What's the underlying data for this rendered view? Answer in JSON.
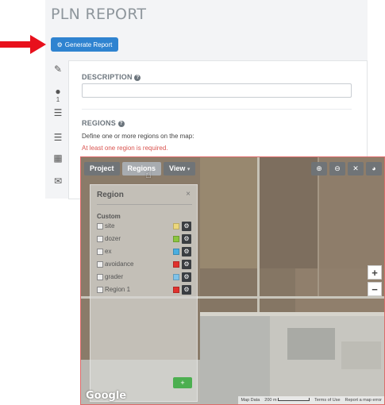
{
  "page": {
    "title": "PLN REPORT"
  },
  "actions": {
    "generate_label": "Generate Report",
    "generate_icon": "gears-icon"
  },
  "sidebar_icons": [
    {
      "name": "pencil-icon",
      "glyph": "✎"
    },
    {
      "name": "globe-icon",
      "glyph": "●",
      "count": "1"
    },
    {
      "name": "list-icon",
      "glyph": "☰"
    },
    {
      "name": "list-icon-2",
      "glyph": "☰"
    },
    {
      "name": "calendar-icon",
      "glyph": "▦"
    },
    {
      "name": "envelope-icon",
      "glyph": "✉"
    }
  ],
  "form": {
    "description_label": "DESCRIPTION",
    "description_value": "",
    "regions_label": "REGIONS",
    "regions_help": "Define one or more regions on the map:",
    "regions_error": "At least one region is required."
  },
  "map": {
    "toolbar": {
      "project": "Project",
      "regions": "Regions",
      "view": "View"
    },
    "tools": [
      "zoom-in-icon",
      "zoom-out-icon",
      "fullscreen-icon",
      "globe-icon"
    ],
    "zoom_in": "+",
    "zoom_out": "−",
    "attribution": {
      "map_data": "Map Data",
      "scale": "200 m",
      "terms": "Terms of Use",
      "report": "Report a map error"
    },
    "logo": "Google"
  },
  "region_panel": {
    "title": "Region",
    "close": "×",
    "group_label": "Custom",
    "items": [
      {
        "name": "site",
        "color": "#ecd77c"
      },
      {
        "name": "dozer",
        "color": "#8bc53f"
      },
      {
        "name": "ex",
        "color": "#4aaee0"
      },
      {
        "name": "avoidance",
        "color": "#e0322e"
      },
      {
        "name": "grader",
        "color": "#7fc3ea"
      },
      {
        "name": "Region 1",
        "color": "#e0322e"
      }
    ],
    "add_label": "+"
  },
  "colors": {
    "accent": "#2f83d0",
    "error": "#d9534f",
    "add": "#4caf50"
  }
}
